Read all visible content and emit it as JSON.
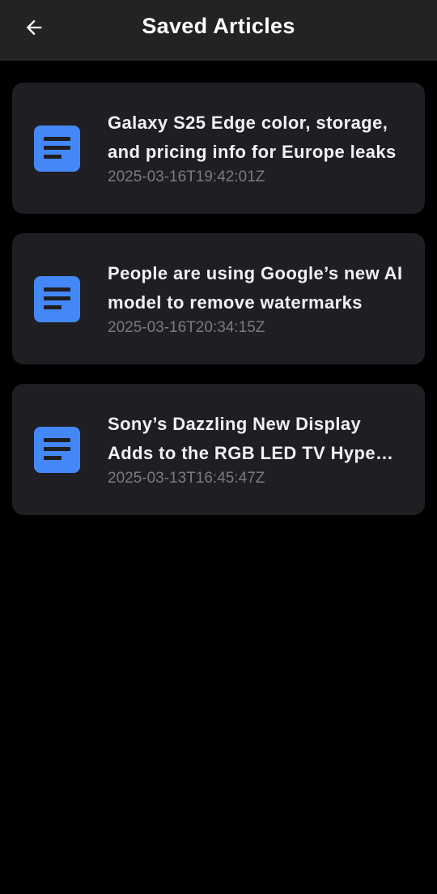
{
  "header": {
    "title": "Saved Articles",
    "back_icon": "arrow-left-icon"
  },
  "articles": [
    {
      "title": "Galaxy S25 Edge color, storage, and pricing info for Europe leaks",
      "date": "2025-03-16T19:42:01Z",
      "icon": "document-icon"
    },
    {
      "title": "People are using Google’s new AI model to remove watermarks",
      "date": "2025-03-16T20:34:15Z",
      "icon": "document-icon"
    },
    {
      "title": "Sony’s Dazzling New Display Adds to the RGB LED TV Hype Train",
      "date": "2025-03-13T16:45:47Z",
      "icon": "document-icon"
    }
  ],
  "colors": {
    "background": "#000000",
    "app_bar": "#232325",
    "card": "#1f1e23",
    "accent_icon": "#4488f7",
    "date_text": "#7b7a80"
  }
}
